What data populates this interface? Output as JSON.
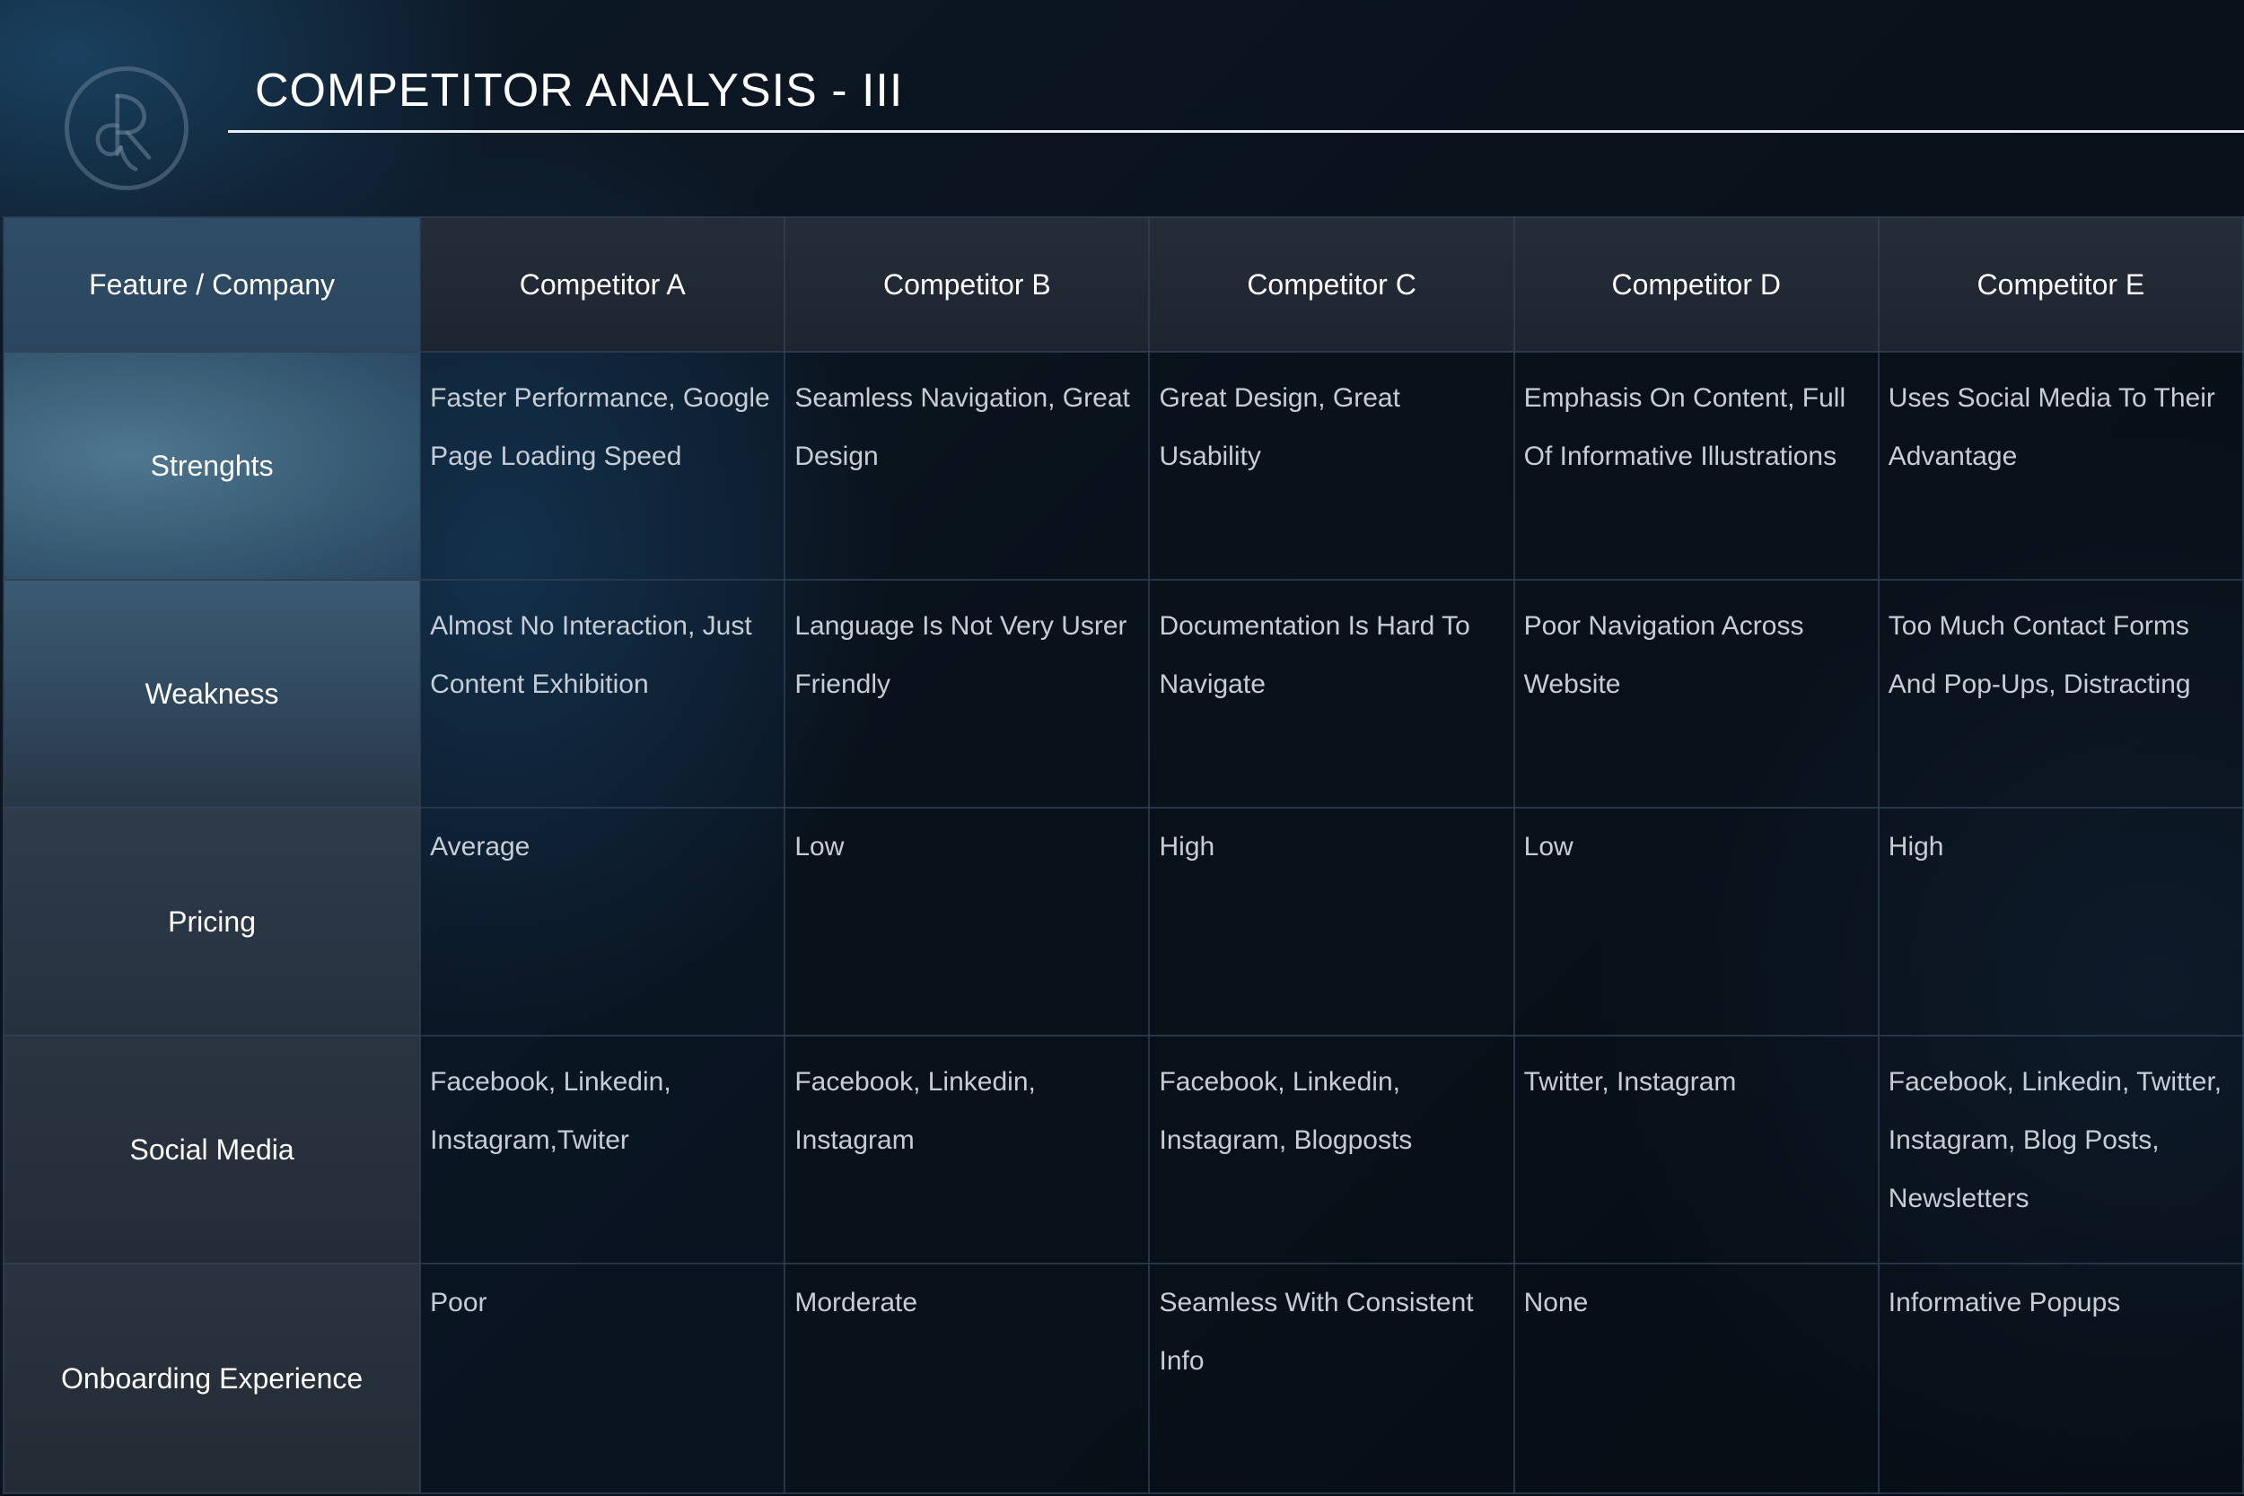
{
  "page": {
    "title": "COMPETITOR ANALYSIS - III",
    "logo": "dr-monogram-logo"
  },
  "table": {
    "header": {
      "feature_label": "Feature / Company",
      "competitors": [
        "Competitor A",
        "Competitor B",
        "Competitor C",
        "Competitor D",
        "Competitor E"
      ]
    },
    "rows": [
      {
        "label": "Strenghts",
        "cells": [
          "Faster Performance, Google Page Loading Speed",
          "Seamless Navigation, Great Design",
          "Great Design, Great Usability",
          "Emphasis On Content, Full Of Informative Illustrations",
          "Uses Social Media To Their Advantage"
        ]
      },
      {
        "label": "Weakness",
        "cells": [
          "Almost No Interaction, Just Content Exhibition",
          "Language Is Not Very Usrer Friendly",
          "Documentation Is Hard To Navigate",
          "Poor Navigation Across Website",
          "Too Much Contact Forms And Pop-Ups, Distracting"
        ]
      },
      {
        "label": "Pricing",
        "cells": [
          "Average",
          "Low",
          "High",
          "Low",
          "High"
        ]
      },
      {
        "label": "Social Media",
        "cells": [
          "Facebook, Linkedin, Instagram,Twiter",
          "Facebook, Linkedin, Instagram",
          "Facebook, Linkedin, Instagram, Blogposts",
          "Twitter, Instagram",
          "Facebook, Linkedin, Twitter, Instagram, Blog Posts, Newsletters"
        ]
      },
      {
        "label": "Onboarding Experience",
        "cells": [
          "Poor",
          "Morderate",
          "Seamless With Consistent Info",
          "None",
          "Informative Popups"
        ]
      }
    ]
  },
  "colors": {
    "title": "#ffffff",
    "rule": "#e9eef3",
    "cell_text": "#c6cdd6",
    "header_feature_bg": "#2f4d66",
    "header_competitor_bg": "#252d39",
    "page_bg": "#0a121c"
  }
}
